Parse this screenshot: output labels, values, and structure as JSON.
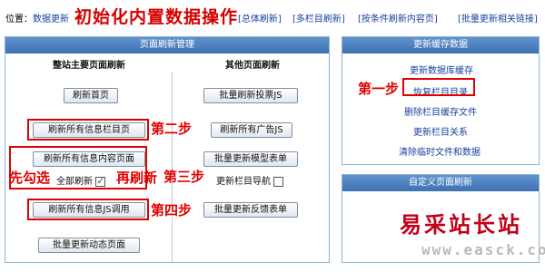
{
  "header": {
    "location_label": "位置：",
    "location_value": "数据更新",
    "big_title": "初始化内置数据操作",
    "links": [
      "[总体刷新]",
      "[多栏目刷新]",
      "[按条件刷新内容页]",
      "[批量更新相关链接]"
    ]
  },
  "main_panel": {
    "title": "页面刷新管理",
    "left_column_title": "整站主要页面刷新",
    "right_column_title": "其他页面刷新",
    "left_buttons": [
      "刷新首页",
      "刷新所有信息栏目页",
      "刷新所有信息内容页面",
      "刷新所有信息JS调用",
      "批量更新动态页面"
    ],
    "full_refresh_label": "全部刷新",
    "full_refresh_checked": true,
    "right_buttons": [
      "批量刷新投票JS",
      "刷新所有广告JS",
      "批量更新模型表单",
      "批量更新反馈表单"
    ],
    "nav_label": "更新栏目导航",
    "nav_checked": false
  },
  "annotations": {
    "step1": "第一步",
    "step2": "第二步",
    "step3": "第三步",
    "step4": "第四步",
    "check_first": "先勾选",
    "refresh_again": "再刷新"
  },
  "cache_panel": {
    "title": "更新缓存数据",
    "links": [
      "更新数据库缓存",
      "恢复栏目目录",
      "删除栏目缓存文件",
      "更新栏目关系",
      "清除临时文件和数据"
    ]
  },
  "custom_panel": {
    "title": "自定义页面刷新"
  },
  "watermark": {
    "cn": "易采站长站",
    "url": "www.easck.com"
  },
  "colors": {
    "accent_red": "#e00000",
    "panel_head": "#4a7fbf",
    "link_blue": "#1a3f9c"
  }
}
